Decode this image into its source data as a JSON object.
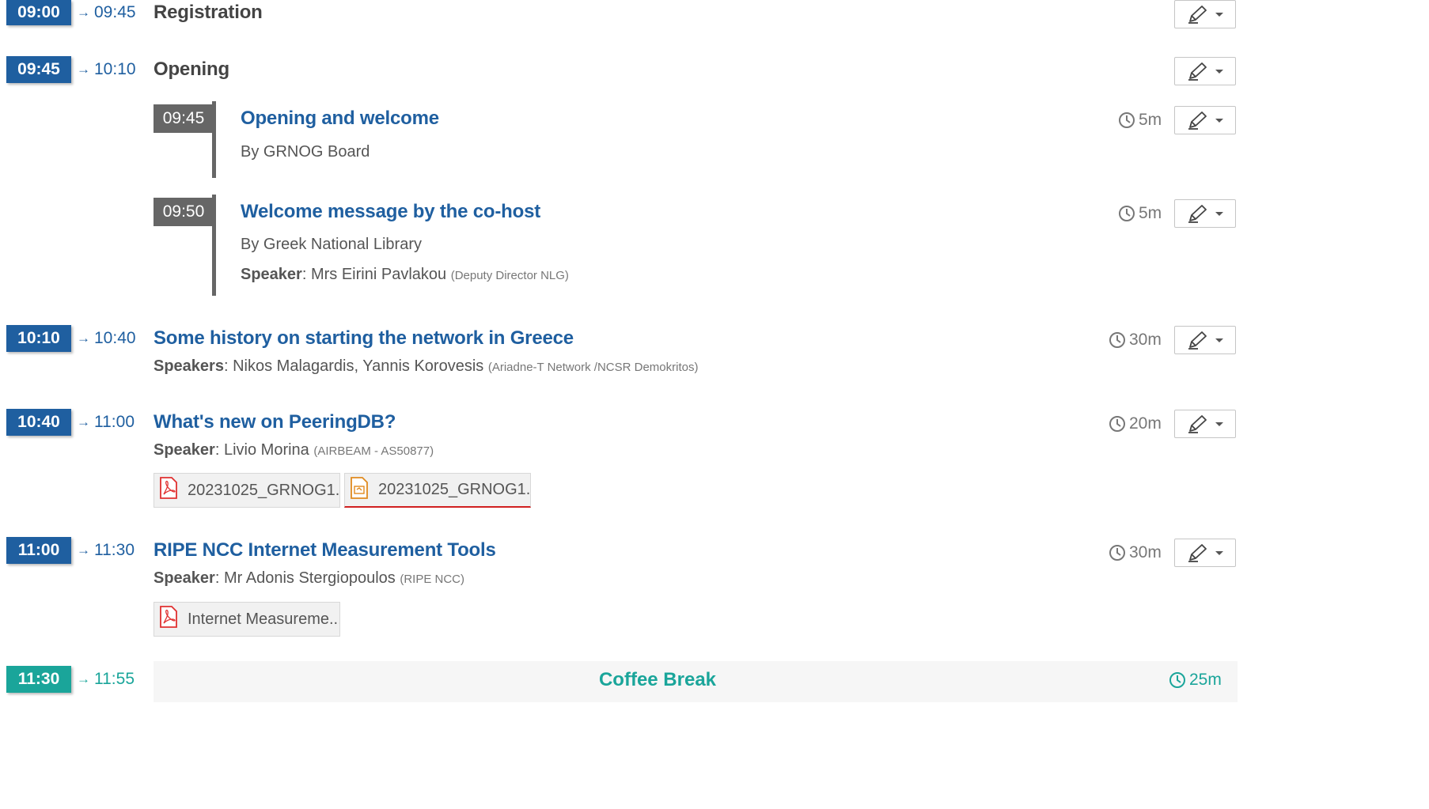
{
  "colors": {
    "primary": "#1f5fa0",
    "break": "#1aa59a",
    "sub_badge": "#666666",
    "pdf": "#e03030",
    "presentation": "#e08a1e"
  },
  "arrow": "→",
  "registration": {
    "start": "09:00",
    "end": "09:45",
    "title": "Registration"
  },
  "opening": {
    "start": "09:45",
    "end": "10:10",
    "title": "Opening",
    "subs": [
      {
        "time": "09:45",
        "title": "Opening and welcome",
        "by": "By GRNOG Board",
        "duration": "5m"
      },
      {
        "time": "09:50",
        "title": "Welcome message by the co-host",
        "by": "By Greek National Library",
        "speaker_label": "Speaker",
        "speaker_sep": ":",
        "speaker": "Mrs Eirini Pavlakou",
        "affiliation": "(Deputy Director NLG)",
        "duration": "5m"
      }
    ]
  },
  "history": {
    "start": "10:10",
    "end": "10:40",
    "title": "Some history on starting the network in Greece",
    "speaker_label": "Speakers",
    "speaker_sep": ":",
    "speaker": "Nikos Malagardis, Yannis Korovesis",
    "affiliation": "(Ariadne-T Network /NCSR Demokritos)",
    "duration": "30m"
  },
  "peeringdb": {
    "start": "10:40",
    "end": "11:00",
    "title": "What's new on PeeringDB?",
    "speaker_label": "Speaker",
    "speaker_sep": ":",
    "speaker": "Livio Morina",
    "affiliation": "(AIRBEAM - AS50877)",
    "duration": "20m",
    "attachments": [
      {
        "label": "20231025_GRNOG1...",
        "icon": "pdf-icon"
      },
      {
        "label": "20231025_GRNOG1...",
        "icon": "presentation-icon"
      }
    ]
  },
  "ripe": {
    "start": "11:00",
    "end": "11:30",
    "title": "RIPE NCC Internet Measurement Tools",
    "speaker_label": "Speaker",
    "speaker_sep": ":",
    "speaker": "Mr Adonis Stergiopoulos",
    "affiliation": "(RIPE NCC)",
    "duration": "30m",
    "attachments": [
      {
        "label": "Internet Measureme...",
        "icon": "pdf-icon"
      }
    ]
  },
  "coffee": {
    "start": "11:30",
    "end": "11:55",
    "title": "Coffee Break",
    "duration": "25m"
  }
}
